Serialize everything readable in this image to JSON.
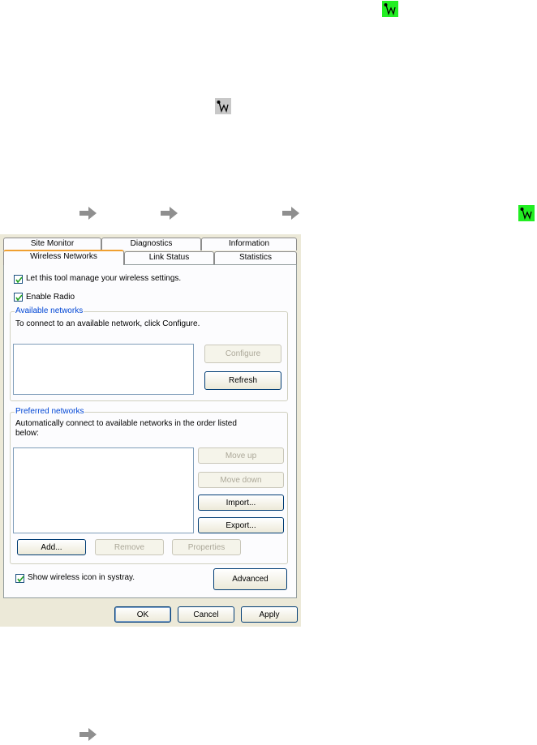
{
  "icons": {
    "tray_active_color": "#22ee22",
    "tray_inactive_color": "#c8c8c8"
  },
  "tabs": {
    "back_row": [
      {
        "label": "Site Monitor"
      },
      {
        "label": "Diagnostics"
      },
      {
        "label": "Information"
      }
    ],
    "front_row": [
      {
        "label": "Wireless Networks",
        "active": true
      },
      {
        "label": "Link Status"
      },
      {
        "label": "Statistics"
      }
    ]
  },
  "settings": {
    "manage_label": "Let this tool manage your wireless settings.",
    "manage_checked": true,
    "radio_label": "Enable Radio",
    "radio_checked": true
  },
  "available": {
    "title": "Available networks",
    "instructions": "To connect to an available network, click Configure.",
    "configure_label": "Configure",
    "refresh_label": "Refresh"
  },
  "preferred": {
    "title": "Preferred networks",
    "instructions_line1": "Automatically connect to available networks in the order listed",
    "instructions_line2": "below:",
    "move_up_label": "Move up",
    "move_down_label": "Move down",
    "import_label": "Import...",
    "export_label": "Export...",
    "add_label": "Add...",
    "remove_label": "Remove",
    "properties_label": "Properties"
  },
  "systray": {
    "label": "Show wireless icon in systray.",
    "checked": true
  },
  "advanced_label": "Advanced",
  "footer": {
    "ok_label": "OK",
    "cancel_label": "Cancel",
    "apply_label": "Apply"
  }
}
